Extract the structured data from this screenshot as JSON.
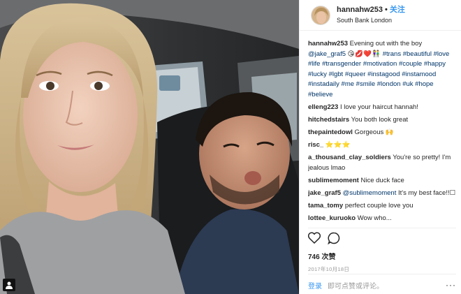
{
  "post": {
    "username": "hannahw253",
    "separator": "•",
    "follow_label": "关注",
    "location": "South Bank London"
  },
  "caption": {
    "user": "hannahw253",
    "text": "Evening out with the boy",
    "mention": "@jake_graf5",
    "emoji": "😘💋❤️👫",
    "hashtags": [
      "#trans",
      "#beautiful",
      "#love",
      "#life",
      "#transgender",
      "#motivation",
      "#couple",
      "#happy",
      "#lucky",
      "#lgbt",
      "#queer",
      "#instagood",
      "#instamood",
      "#instadaily",
      "#me",
      "#smile",
      "#london",
      "#uk",
      "#hope",
      "#believe"
    ]
  },
  "comments": [
    {
      "user": "elleng223",
      "text": "I love your haircut hannah!"
    },
    {
      "user": "hitchedstairs",
      "text": "You both look great"
    },
    {
      "user": "thepaintedowl",
      "text": "Gorgeous 🙌"
    },
    {
      "user": "risc_",
      "text": "⭐⭐⭐"
    },
    {
      "user": "a_thousand_clay_soldiers",
      "text": "You're so pretty! I'm jealous lmao"
    },
    {
      "user": "sublimemoment",
      "text": "Nice duck face"
    },
    {
      "user": "jake_graf5",
      "mention": "@sublimemoment",
      "text": "It's my best face!!☐"
    },
    {
      "user": "tama_tomy",
      "text": "perfect couple love you"
    },
    {
      "user": "lottee_kuruoko",
      "text": "Wow who..."
    }
  ],
  "actions": {
    "like_icon": "heart-outline-icon",
    "comment_icon": "speech-bubble-icon",
    "likes": "746 次赞",
    "date": "2017年10月18日"
  },
  "footer": {
    "login_label": "登录",
    "prompt": "即可点赞或评论。",
    "more_label": "···"
  },
  "colors": {
    "link": "#3897f0",
    "hashtag": "#003569",
    "text": "#262626",
    "muted": "#999999"
  }
}
